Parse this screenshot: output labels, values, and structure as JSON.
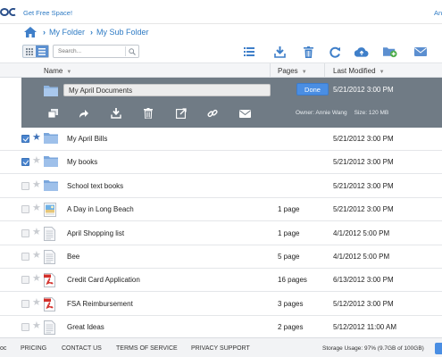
{
  "header": {
    "logo_text": "oc",
    "free_space_link": "Get Free Space!",
    "top_right_link": "An"
  },
  "breadcrumb": {
    "items": [
      "My Folder",
      "My Sub Folder"
    ]
  },
  "toolbar": {
    "search_placeholder": "Search...",
    "icons": [
      "list-view-icon",
      "download-icon",
      "trash-icon",
      "refresh-icon",
      "cloud-upload-icon",
      "add-folder-icon",
      "email-icon"
    ]
  },
  "columns": {
    "name": "Name",
    "pages": "Pages",
    "modified": "Last Modified"
  },
  "editing": {
    "name_value": "My April Documents",
    "done_label": "Done",
    "date": "5/21/2012 3:00 PM",
    "owner": "Owner: Annie Wang",
    "size": "Size: 120 MB",
    "actions": [
      "copy-icon",
      "share-arrow-icon",
      "download-icon",
      "trash-icon",
      "export-icon",
      "link-icon",
      "email-icon"
    ]
  },
  "files": [
    {
      "name": "My April Bills",
      "pages": "",
      "modified": "5/21/2012 3:00 PM",
      "type": "folder",
      "checked": true,
      "starred": true
    },
    {
      "name": "My books",
      "pages": "",
      "modified": "5/21/2012 3:00 PM",
      "type": "folder",
      "checked": true,
      "starred": false
    },
    {
      "name": "School text books",
      "pages": "",
      "modified": "5/21/2012 3:00 PM",
      "type": "folder",
      "checked": false,
      "starred": false
    },
    {
      "name": "A Day in Long Beach",
      "pages": "1 page",
      "modified": "5/21/2012 3:00 PM",
      "type": "image",
      "checked": false,
      "starred": false
    },
    {
      "name": "April Shopping list",
      "pages": "1 page",
      "modified": "4/1/2012 5:00 PM",
      "type": "doc",
      "checked": false,
      "starred": false
    },
    {
      "name": "Bee",
      "pages": "5 page",
      "modified": "4/1/2012 5:00 PM",
      "type": "doc",
      "checked": false,
      "starred": false
    },
    {
      "name": "Credit Card Application",
      "pages": "16 pages",
      "modified": "6/13/2012 3:00 PM",
      "type": "pdf",
      "checked": false,
      "starred": false
    },
    {
      "name": "FSA Reimbursement",
      "pages": "3 pages",
      "modified": "5/12/2012 3:00 PM",
      "type": "pdf",
      "checked": false,
      "starred": false
    },
    {
      "name": "Great Ideas",
      "pages": "2 pages",
      "modified": "5/12/2012 11:00 AM",
      "type": "doc",
      "checked": false,
      "starred": false
    }
  ],
  "footer": {
    "links": [
      "oc",
      "PRICING",
      "CONTACT US",
      "TERMS OF SERVICE",
      "PRIVACY SUPPORT"
    ],
    "storage": "Storage Usage: 97% (9.7GB of 100GB)"
  },
  "colors": {
    "accent": "#2f7bc4",
    "edit_panel": "#707b85",
    "button": "#4a8ee3",
    "folder": "#8fb6e3"
  }
}
